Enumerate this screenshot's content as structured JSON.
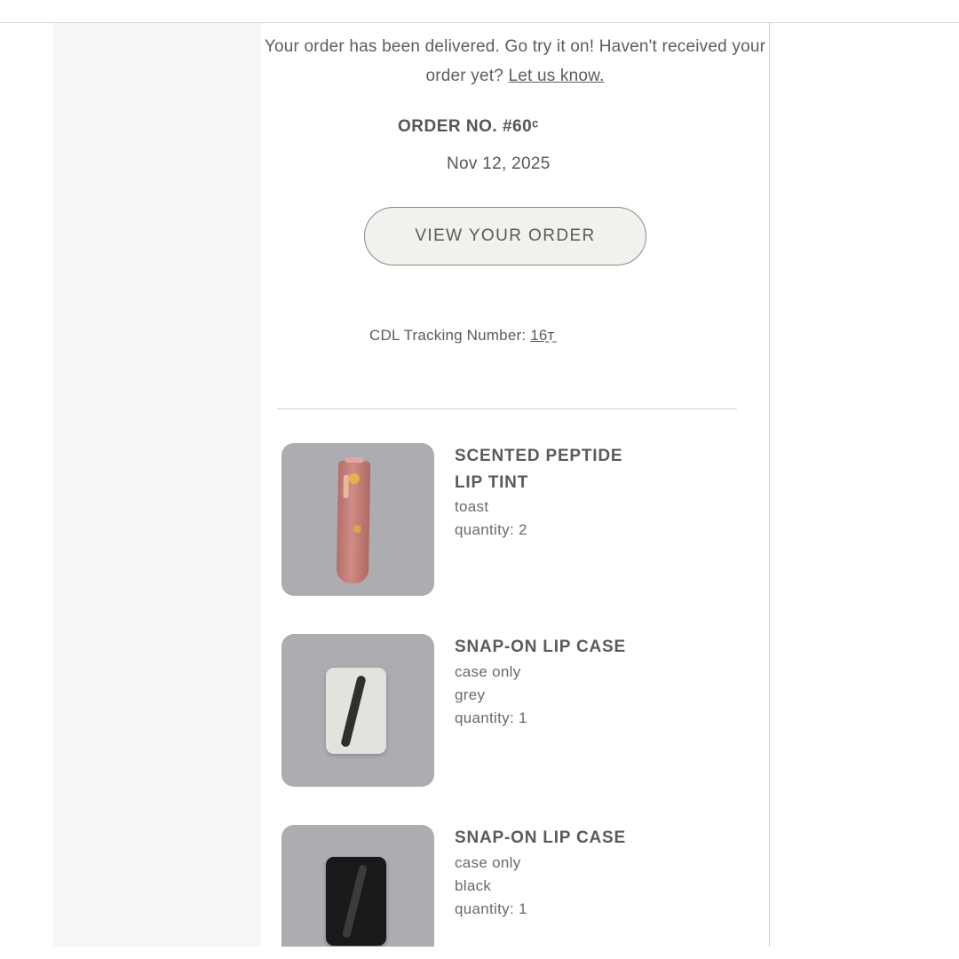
{
  "message": {
    "text": "Your order has been delivered. Go try it on! Haven't received your order yet?",
    "link": "Let us know."
  },
  "order": {
    "label": "ORDER NO. #60ᶜ",
    "date": "Nov 12, 2025",
    "button": "VIEW YOUR ORDER",
    "tracking_label": "CDL Tracking Number:",
    "tracking_number": "16̱т̼"
  },
  "items": [
    {
      "title": "SCENTED PEPTIDE LIP TINT",
      "details": [
        "toast",
        "quantity: 2"
      ],
      "thumb_color": "#acacb1",
      "icon": "lip-tint-tube"
    },
    {
      "title": "SNAP-ON LIP CASE",
      "details": [
        "case only",
        "grey",
        "quantity: 1"
      ],
      "thumb_color": "#acacb1",
      "icon": "lip-case-grey"
    },
    {
      "title": "SNAP-ON LIP CASE",
      "details": [
        "case only",
        "black",
        "quantity: 1"
      ],
      "thumb_color": "#acacb1",
      "icon": "lip-case-black"
    }
  ]
}
